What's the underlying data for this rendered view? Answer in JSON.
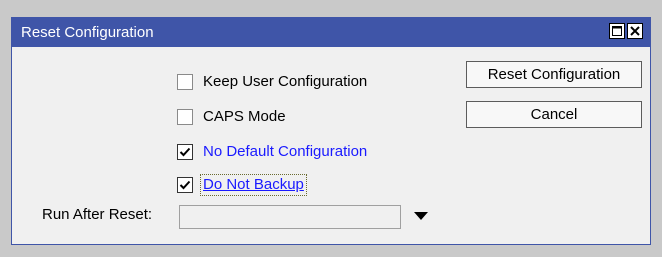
{
  "window": {
    "title": "Reset Configuration"
  },
  "options": [
    {
      "label": "Keep User Configuration",
      "checked": false
    },
    {
      "label": "CAPS Mode",
      "checked": false
    },
    {
      "label": "No Default Configuration",
      "checked": true
    },
    {
      "label": "Do Not Backup",
      "checked": true
    }
  ],
  "buttons": {
    "reset_label": "Reset Configuration",
    "cancel_label": "Cancel"
  },
  "run_after_reset": {
    "label": "Run After Reset:",
    "value": ""
  },
  "colors": {
    "titlebar": "#3f55a8",
    "changed_option_text": "#1a1aff"
  },
  "icons": {
    "maximize": "maximize-icon",
    "close": "close-icon",
    "dropdown": "dropdown-arrow-icon",
    "check": "checkmark-icon"
  }
}
